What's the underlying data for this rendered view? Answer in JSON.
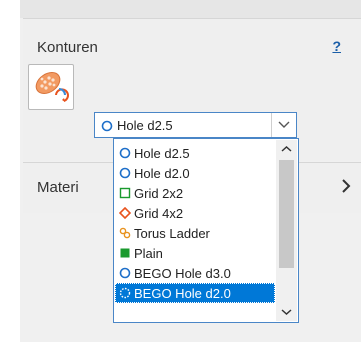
{
  "konturen": {
    "title": "Konturen",
    "help": "?"
  },
  "select": {
    "value": "Hole d2.5",
    "value_icon": "circle-outline-icon"
  },
  "material": {
    "label": "Materi"
  },
  "dropdown": {
    "options": [
      {
        "label": "Hole d2.5",
        "icon": "circle-outline-icon",
        "color": "#1e6fc9"
      },
      {
        "label": "Hole d2.0",
        "icon": "circle-outline-icon",
        "color": "#1e6fc9"
      },
      {
        "label": "Grid 2x2",
        "icon": "square-outline-icon",
        "color": "#1a9a2e"
      },
      {
        "label": "Grid 4x2",
        "icon": "diamond-outline-icon",
        "color": "#e8531e"
      },
      {
        "label": "Torus Ladder",
        "icon": "torus-ladder-icon",
        "color": "#e8921e"
      },
      {
        "label": "Plain",
        "icon": "square-filled-icon",
        "color": "#1a9a2e"
      },
      {
        "label": "BEGO Hole d3.0",
        "icon": "circle-outline-icon",
        "color": "#1e6fc9"
      },
      {
        "label": "BEGO Hole d2.0",
        "icon": "circle-dashed-icon",
        "color": "#ffffff"
      }
    ],
    "selected_index": 7
  },
  "colors": {
    "accent": "#0078d7",
    "border": "#4a86c7",
    "link": "#1a5ea8"
  }
}
